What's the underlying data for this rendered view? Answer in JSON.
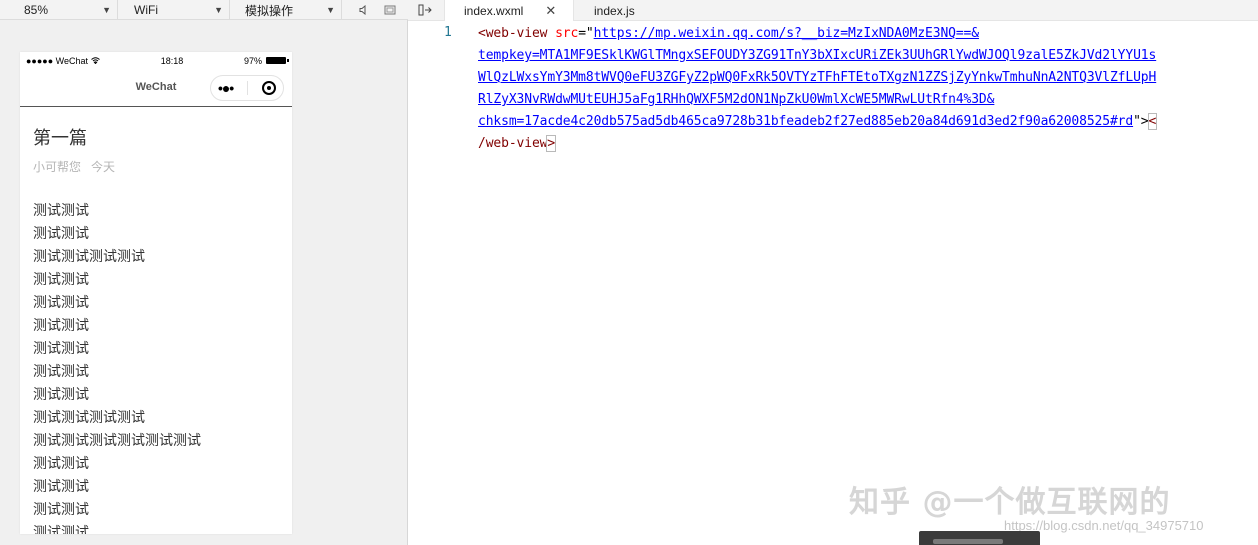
{
  "toolbar": {
    "zoom": "85%",
    "network": "WiFi",
    "operation": "模拟操作"
  },
  "phone": {
    "carrier": "●●●●● WeChat",
    "time": "18:18",
    "battery": "97%",
    "nav_title": "WeChat"
  },
  "article": {
    "title": "第一篇",
    "author": "小可帮您",
    "date": "今天",
    "lines": [
      "测试测试",
      "测试测试",
      "测试测试测试测试",
      "测试测试",
      "测试测试",
      "测试测试",
      "测试测试",
      "测试测试",
      "测试测试",
      "测试测试测试测试",
      "测试测试测试测试测试测试",
      "测试测试",
      "测试测试",
      "测试测试",
      "测试测试"
    ]
  },
  "editor": {
    "tabs": [
      {
        "label": "index.wxml",
        "active": true
      },
      {
        "label": "index.js",
        "active": false
      }
    ],
    "line_number": "1",
    "code": {
      "tag_open": "<web-view",
      "attr_name": "src",
      "eq": "=\"",
      "url_lines": [
        "https://mp.weixin.qq.com/s?__biz=MzIxNDA0MzE3NQ==&",
        "tempkey=MTA1MF9ESklKWGlTMngxSEFOUDY3ZG91TnY3bXIxcURiZEk3UUhGRlYwdWJOQl9zalE5ZkJVd2lYYU1s",
        "WlQzLWxsYmY3Mm8tWVQ0eFU3ZGFyZ2pWQ0FxRk5OVTYzTFhFTEtoTXgzN1ZZSjZyYnkwTmhuNnA2NTQ3VlZfLUpH",
        "RlZyX3NvRWdwMUtEUHJ5aFg1RHhQWXF5M2dON1NpZkU0WmlXcWE5MWRwLUtRfn4%3D&",
        "chksm=17acde4c20db575ad5db465ca9728b31bfeadeb2f27ed885eb20a84d691d3ed2f90a62008525#rd"
      ],
      "close_quote": "\">",
      "lt": "<",
      "tag_close": "/web-view",
      "gt": ">"
    }
  },
  "watermark": {
    "zhihu": "知乎 @一个做互联网的",
    "csdn": "https://blog.csdn.net/qq_34975710"
  },
  "colors": {
    "tag": "#800000",
    "attr": "#ff0000",
    "string": "#0000ff",
    "line_number": "#237893"
  }
}
